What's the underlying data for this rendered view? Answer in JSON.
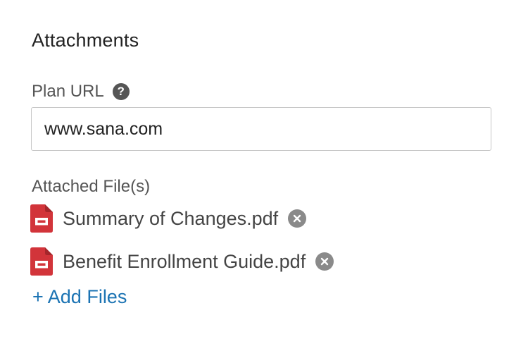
{
  "section": {
    "title": "Attachments"
  },
  "plan_url": {
    "label": "Plan URL",
    "help_icon": "question-mark-circle-icon",
    "value": "www.sana.com"
  },
  "attached_files": {
    "label": "Attached File(s)",
    "file_icon": "pdf-document-icon",
    "remove_icon": "close-circle-icon",
    "files": [
      {
        "name": "Summary of Changes.pdf"
      },
      {
        "name": "Benefit Enrollment Guide.pdf"
      }
    ],
    "add_files_label": "+ Add Files"
  },
  "colors": {
    "link": "#1b73b3",
    "pdf_icon": "#d2343a",
    "remove_icon": "#8a8a8a",
    "help_icon": "#555555"
  }
}
